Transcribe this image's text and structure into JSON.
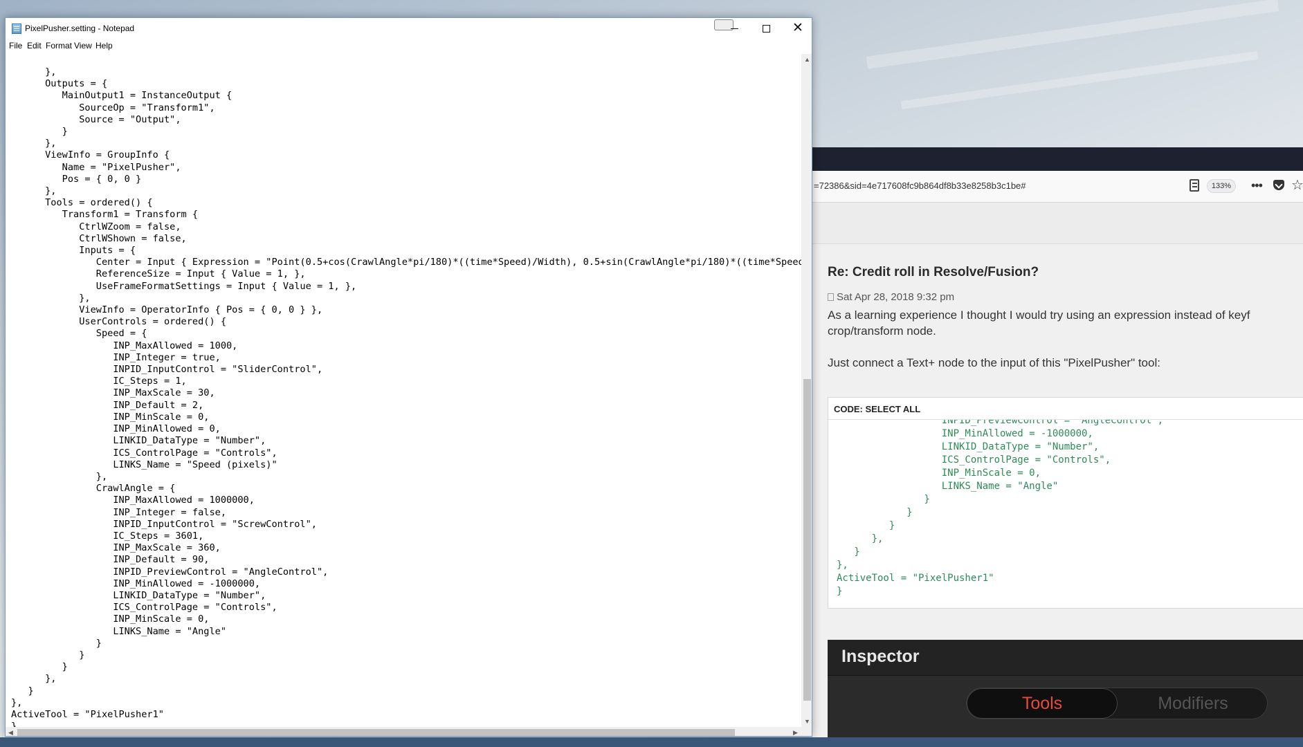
{
  "notepad": {
    "title": "PixelPusher.setting - Notepad",
    "menu": [
      "File",
      "Edit",
      "Format",
      "View",
      "Help"
    ],
    "content": "      },\n      Outputs = {\n         MainOutput1 = InstanceOutput {\n            SourceOp = \"Transform1\",\n            Source = \"Output\",\n         }\n      },\n      ViewInfo = GroupInfo {\n         Name = \"PixelPusher\",\n         Pos = { 0, 0 }\n      },\n      Tools = ordered() {\n         Transform1 = Transform {\n            CtrlWZoom = false,\n            CtrlWShown = false,\n            Inputs = {\n               Center = Input { Expression = \"Point(0.5+cos(CrawlAngle*pi/180)*((time*Speed)/Width), 0.5+sin(CrawlAngle*pi/180)*((time*Speed)/H\n               ReferenceSize = Input { Value = 1, },\n               UseFrameFormatSettings = Input { Value = 1, },\n            },\n            ViewInfo = OperatorInfo { Pos = { 0, 0 } },\n            UserControls = ordered() {\n               Speed = {\n                  INP_MaxAllowed = 1000,\n                  INP_Integer = true,\n                  INPID_InputControl = \"SliderControl\",\n                  IC_Steps = 1,\n                  INP_MaxScale = 30,\n                  INP_Default = 2,\n                  INP_MinScale = 0,\n                  INP_MinAllowed = 0,\n                  LINKID_DataType = \"Number\",\n                  ICS_ControlPage = \"Controls\",\n                  LINKS_Name = \"Speed (pixels)\"\n               },\n               CrawlAngle = {\n                  INP_MaxAllowed = 1000000,\n                  INP_Integer = false,\n                  INPID_InputControl = \"ScrewControl\",\n                  IC_Steps = 3601,\n                  INP_MaxScale = 360,\n                  INP_Default = 90,\n                  INPID_PreviewControl = \"AngleControl\",\n                  INP_MinAllowed = -1000000,\n                  LINKID_DataType = \"Number\",\n                  ICS_ControlPage = \"Controls\",\n                  INP_MinScale = 0,\n                  LINKS_Name = \"Angle\"\n               }\n            }\n         }\n      },\n   }\n},\nActiveTool = \"PixelPusher1\"\n}"
  },
  "browser": {
    "url": "=72386&sid=4e717608fc9b864df8b33e8258b3c1be#",
    "zoom": "133%",
    "post_title": "Re: Credit roll in Resolve/Fusion?",
    "post_date": "Sat Apr 28, 2018 9:32 pm",
    "post_line1": "As a learning experience I thought I would try using an expression instead of keyf",
    "post_line2": "crop/transform node.",
    "post_line3": "Just connect a Text+ node to the input of this \"PixelPusher\" tool:",
    "code_header": "CODE: SELECT ALL",
    "code_snippet": "                  INPID_PreviewControl = \"AngleControl\",\n                  INP_MinAllowed = -1000000,\n                  LINKID_DataType = \"Number\",\n                  ICS_ControlPage = \"Controls\",\n                  INP_MinScale = 0,\n                  LINKS_Name = \"Angle\"\n               }\n            }\n         }\n      },\n   }\n},\nActiveTool = \"PixelPusher1\"\n}"
  },
  "inspector": {
    "title": "Inspector",
    "tab_tools": "Tools",
    "tab_modifiers": "Modifiers"
  },
  "colors": {
    "tools_accent": "#e64b3c",
    "code_green": "#2e8b57",
    "browser_topbar": "#1e2230"
  }
}
